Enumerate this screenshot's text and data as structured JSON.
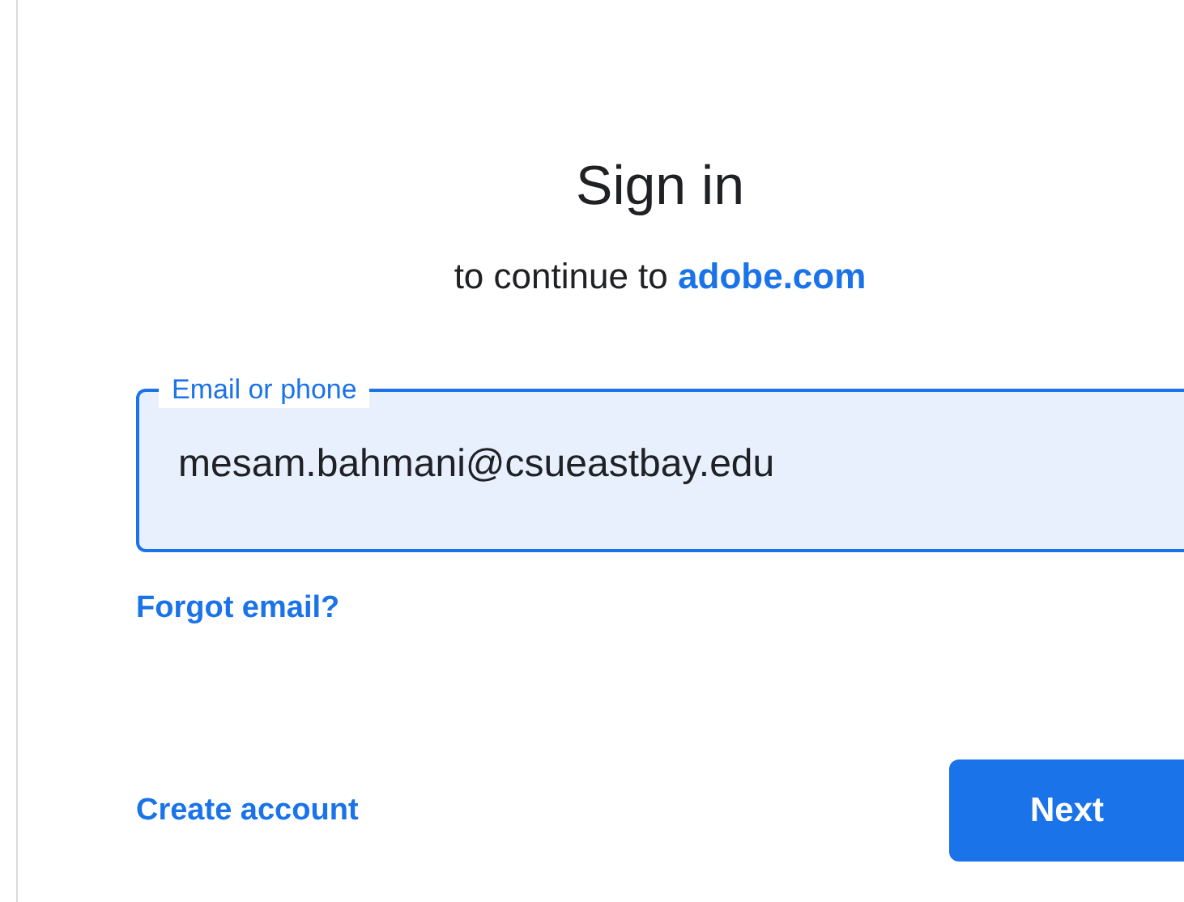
{
  "title": "Sign in",
  "subtitle": {
    "text": "to continue to",
    "link": "adobe.com"
  },
  "email_field": {
    "label": "Email or phone",
    "value": "mesam.bahmani@csueastbay.edu",
    "focused": true
  },
  "forgot_link": "Forgot email?",
  "create_account_link": "Create account",
  "next_button": "Next"
}
